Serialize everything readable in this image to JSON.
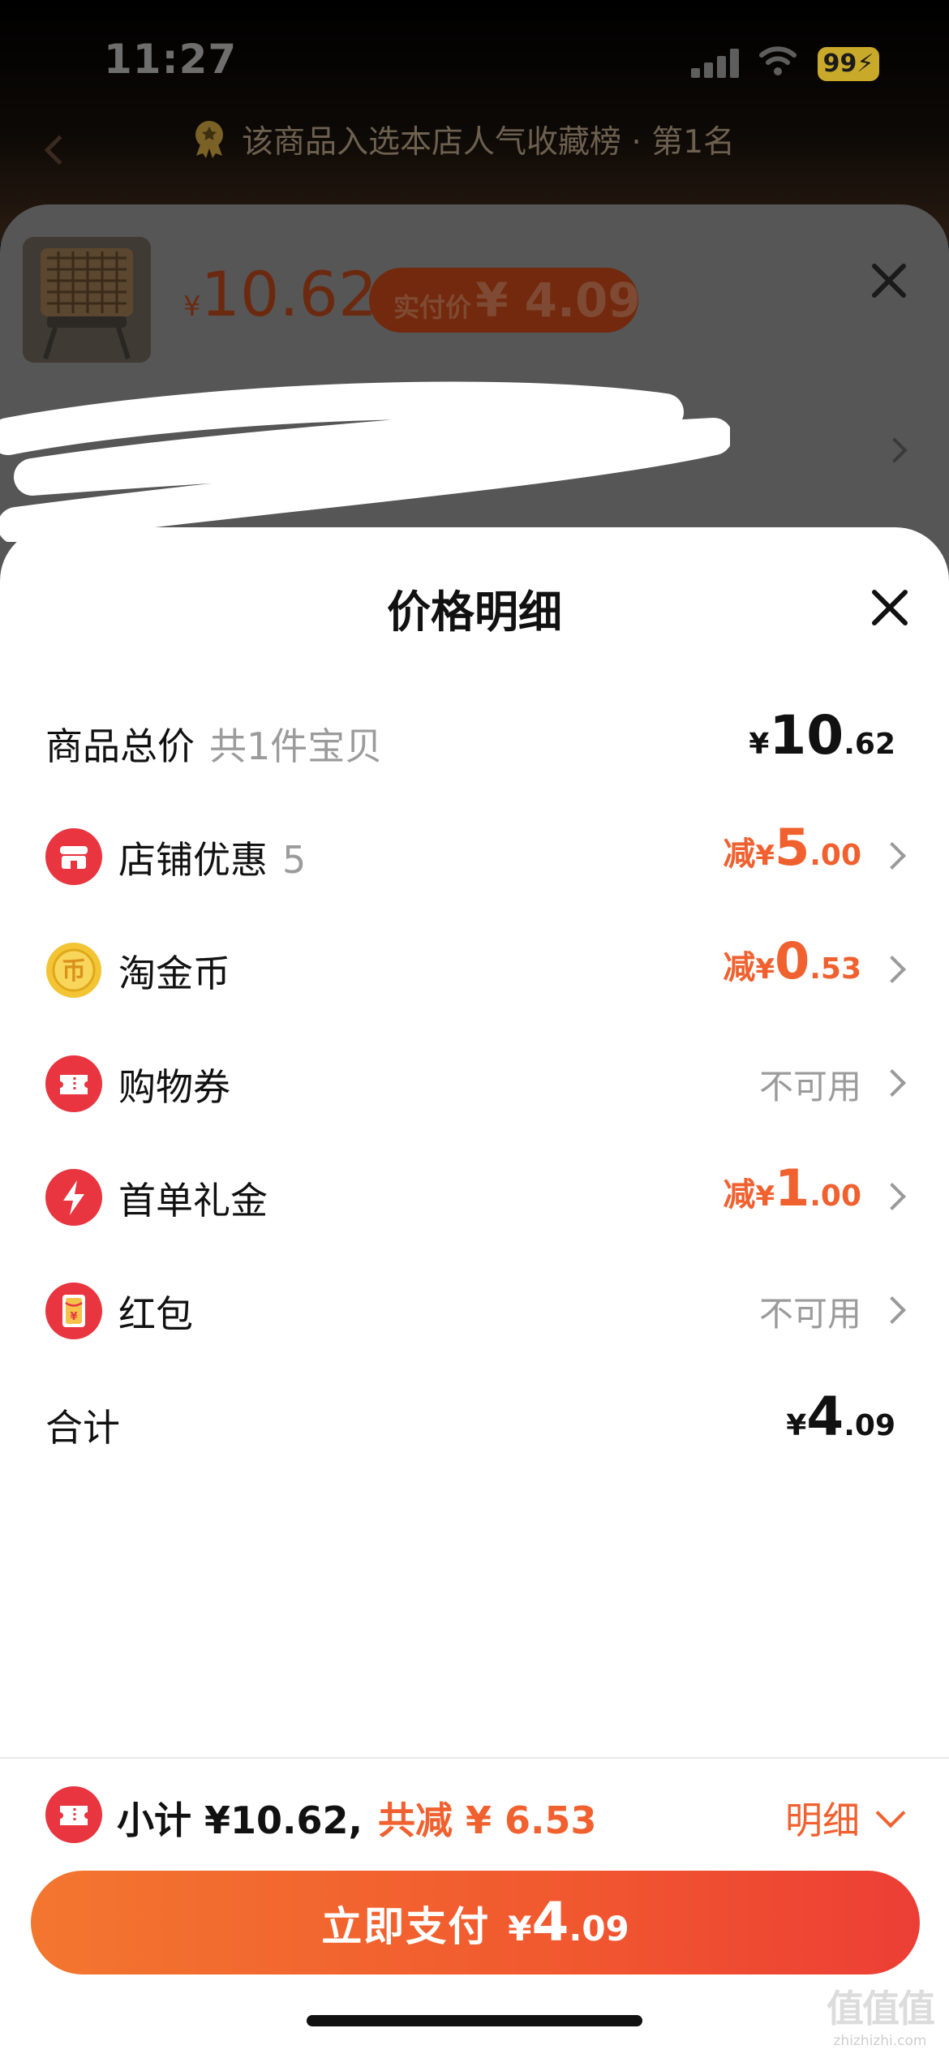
{
  "status_bar": {
    "time": "11:27",
    "battery": "99"
  },
  "background": {
    "rank_text": "该商品入选本店人气收藏榜 · 第1名",
    "sku": {
      "currency": "¥",
      "price": "10.62",
      "badge_label": "实付价",
      "badge_price": "¥ 4.09"
    }
  },
  "price_detail": {
    "title": "价格明细",
    "rows": [
      {
        "label": "商品总价",
        "sub": "共1件宝贝",
        "currency": "¥",
        "int": "10",
        "dec": ".62"
      },
      {
        "label": "店铺优惠",
        "sub": "5",
        "prefix": "减",
        "currency": "¥",
        "int": "5",
        "dec": ".00"
      },
      {
        "label": "淘金币",
        "prefix": "减",
        "currency": "¥",
        "int": "0",
        "dec": ".53"
      },
      {
        "label": "购物券",
        "status": "不可用"
      },
      {
        "label": "首单礼金",
        "prefix": "减",
        "currency": "¥",
        "int": "1",
        "dec": ".00"
      },
      {
        "label": "红包",
        "status": "不可用"
      },
      {
        "label": "合计",
        "currency": "¥",
        "int": "4",
        "dec": ".09"
      }
    ]
  },
  "summary": {
    "subtotal": "小计 ¥10.62,",
    "discount": "共减 ¥ 6.53",
    "detail_label": "明细"
  },
  "pay_button": {
    "label": "立即支付",
    "currency": "¥",
    "int": "4",
    "dec": ".09"
  },
  "watermark": {
    "cn": "值值值",
    "en": "zhizhizhi.com"
  },
  "colors": {
    "accent": "#f0612f",
    "coupon_red": "#e8353f",
    "coin_gold": "#f3c433"
  }
}
